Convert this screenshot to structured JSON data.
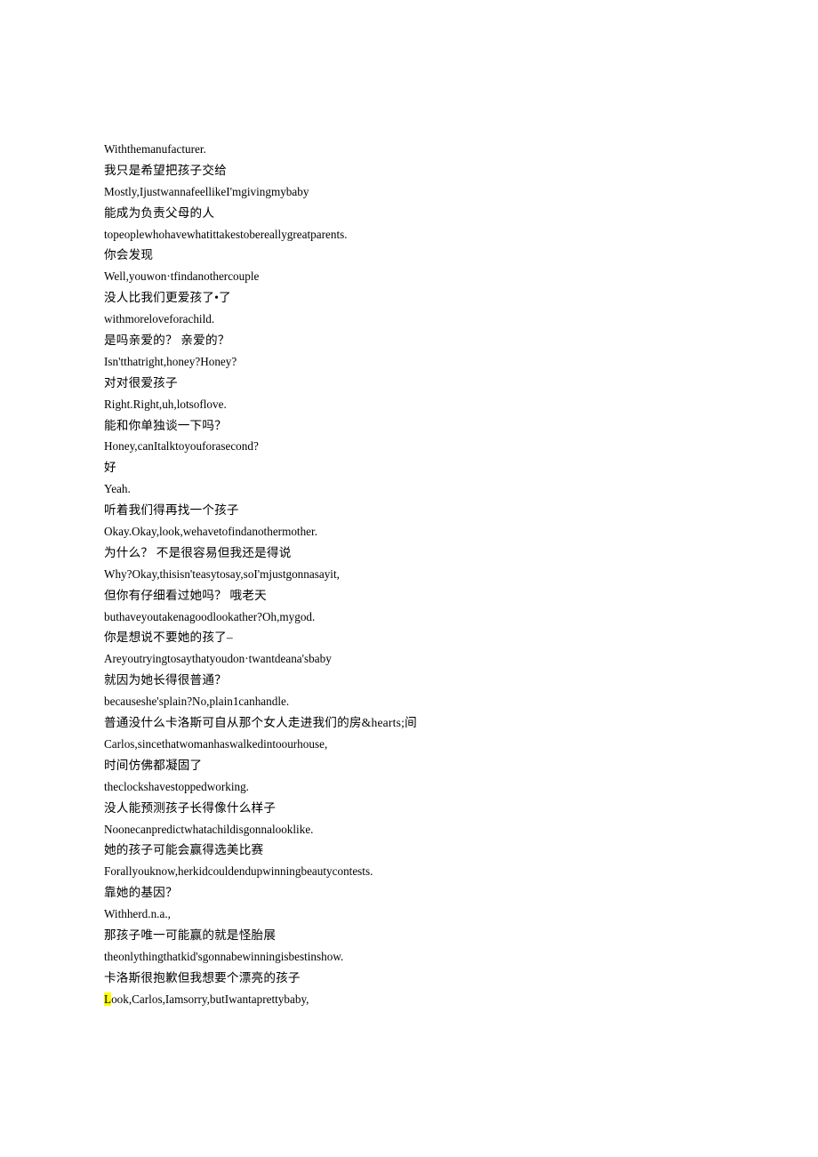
{
  "document": {
    "background_color": "#ffffff",
    "text_color": "#000000",
    "highlight_color": "#ffff00"
  },
  "transcript": {
    "lines": [
      {
        "lang": "en",
        "text": "Withthemanufacturer."
      },
      {
        "lang": "zh",
        "text": "我只是希望把孩子交给"
      },
      {
        "lang": "en",
        "text": "Mostly,IjustwannafeellikeI'mgivingmybaby"
      },
      {
        "lang": "zh",
        "text": "能成为负责父母的人"
      },
      {
        "lang": "en",
        "text": "topeoplewhohavewhatittakestobereallygreatparents."
      },
      {
        "lang": "zh",
        "text": "你会发现"
      },
      {
        "lang": "en",
        "text": "Well,youwon·tfindanothercouple"
      },
      {
        "lang": "zh",
        "text": "没人比我们更爱孩了•了"
      },
      {
        "lang": "en",
        "text": "withmoreloveforachild."
      },
      {
        "lang": "zh",
        "text": "是吗亲爱的？ 亲爱的？"
      },
      {
        "lang": "en",
        "text": "Isn'tthatright,honey?Honey?"
      },
      {
        "lang": "zh",
        "text": "对对很爱孩子"
      },
      {
        "lang": "en",
        "text": "Right.Right,uh,lotsoflove."
      },
      {
        "lang": "zh",
        "text": "能和你单独谈一下吗？"
      },
      {
        "lang": "en",
        "text": "Honey,canItalktoyouforasecond?"
      },
      {
        "lang": "zh",
        "text": "好"
      },
      {
        "lang": "en",
        "text": "Yeah."
      },
      {
        "lang": "zh",
        "text": "听着我们得再找一个孩子"
      },
      {
        "lang": "en",
        "text": "Okay.Okay,look,wehavetofindanothermother."
      },
      {
        "lang": "zh",
        "text": "为什么？ 不是很容易但我还是得说"
      },
      {
        "lang": "en",
        "text": "Why?Okay,thisisn'teasytosay,soI'mjustgonnasayit,"
      },
      {
        "lang": "zh",
        "text": "但你有仔细看过她吗？ 哦老天"
      },
      {
        "lang": "en",
        "text": "buthaveyoutakenagoodlookather?Oh,mygod."
      },
      {
        "lang": "zh",
        "text": "你是想说不要她的孩了–"
      },
      {
        "lang": "en",
        "text": "Areyoutryingtosaythatyoudon·twantdeana'sbaby"
      },
      {
        "lang": "zh",
        "text": "就因为她长得很普通？"
      },
      {
        "lang": "en",
        "text": "becauseshe'splain?No,plain1canhandle."
      },
      {
        "lang": "zh",
        "text": "普通没什么卡洛斯可自从那个女人走进我们的房&hearts;间"
      },
      {
        "lang": "en",
        "text": "Carlos,sincethatwomanhaswalkedintoourhouse,"
      },
      {
        "lang": "zh",
        "text": "时间仿佛都凝固了"
      },
      {
        "lang": "en",
        "text": "theclockshavestoppedworking."
      },
      {
        "lang": "zh",
        "text": "没人能预测孩子长得像什么样子"
      },
      {
        "lang": "en",
        "text": "Noonecanpredictwhatachildisgonnalooklike."
      },
      {
        "lang": "zh",
        "text": "她的孩子可能会赢得选美比赛"
      },
      {
        "lang": "en",
        "text": "Forallyouknow,herkidcouldendupwinningbeautycontests."
      },
      {
        "lang": "zh",
        "text": "靠她的基因？"
      },
      {
        "lang": "en",
        "text": "Withherd.n.a.,"
      },
      {
        "lang": "zh",
        "text": "那孩子唯一可能赢的就是怪胎展"
      },
      {
        "lang": "en",
        "text": "theonlythingthatkid'sgonnabewinningisbestinshow."
      },
      {
        "lang": "zh",
        "text": "卡洛斯很抱歉但我想要个漂亮的孩子"
      },
      {
        "lang": "en",
        "highlight_prefix": "L",
        "text": "ook,Carlos,Iamsorry,butIwantaprettybaby,"
      }
    ]
  }
}
